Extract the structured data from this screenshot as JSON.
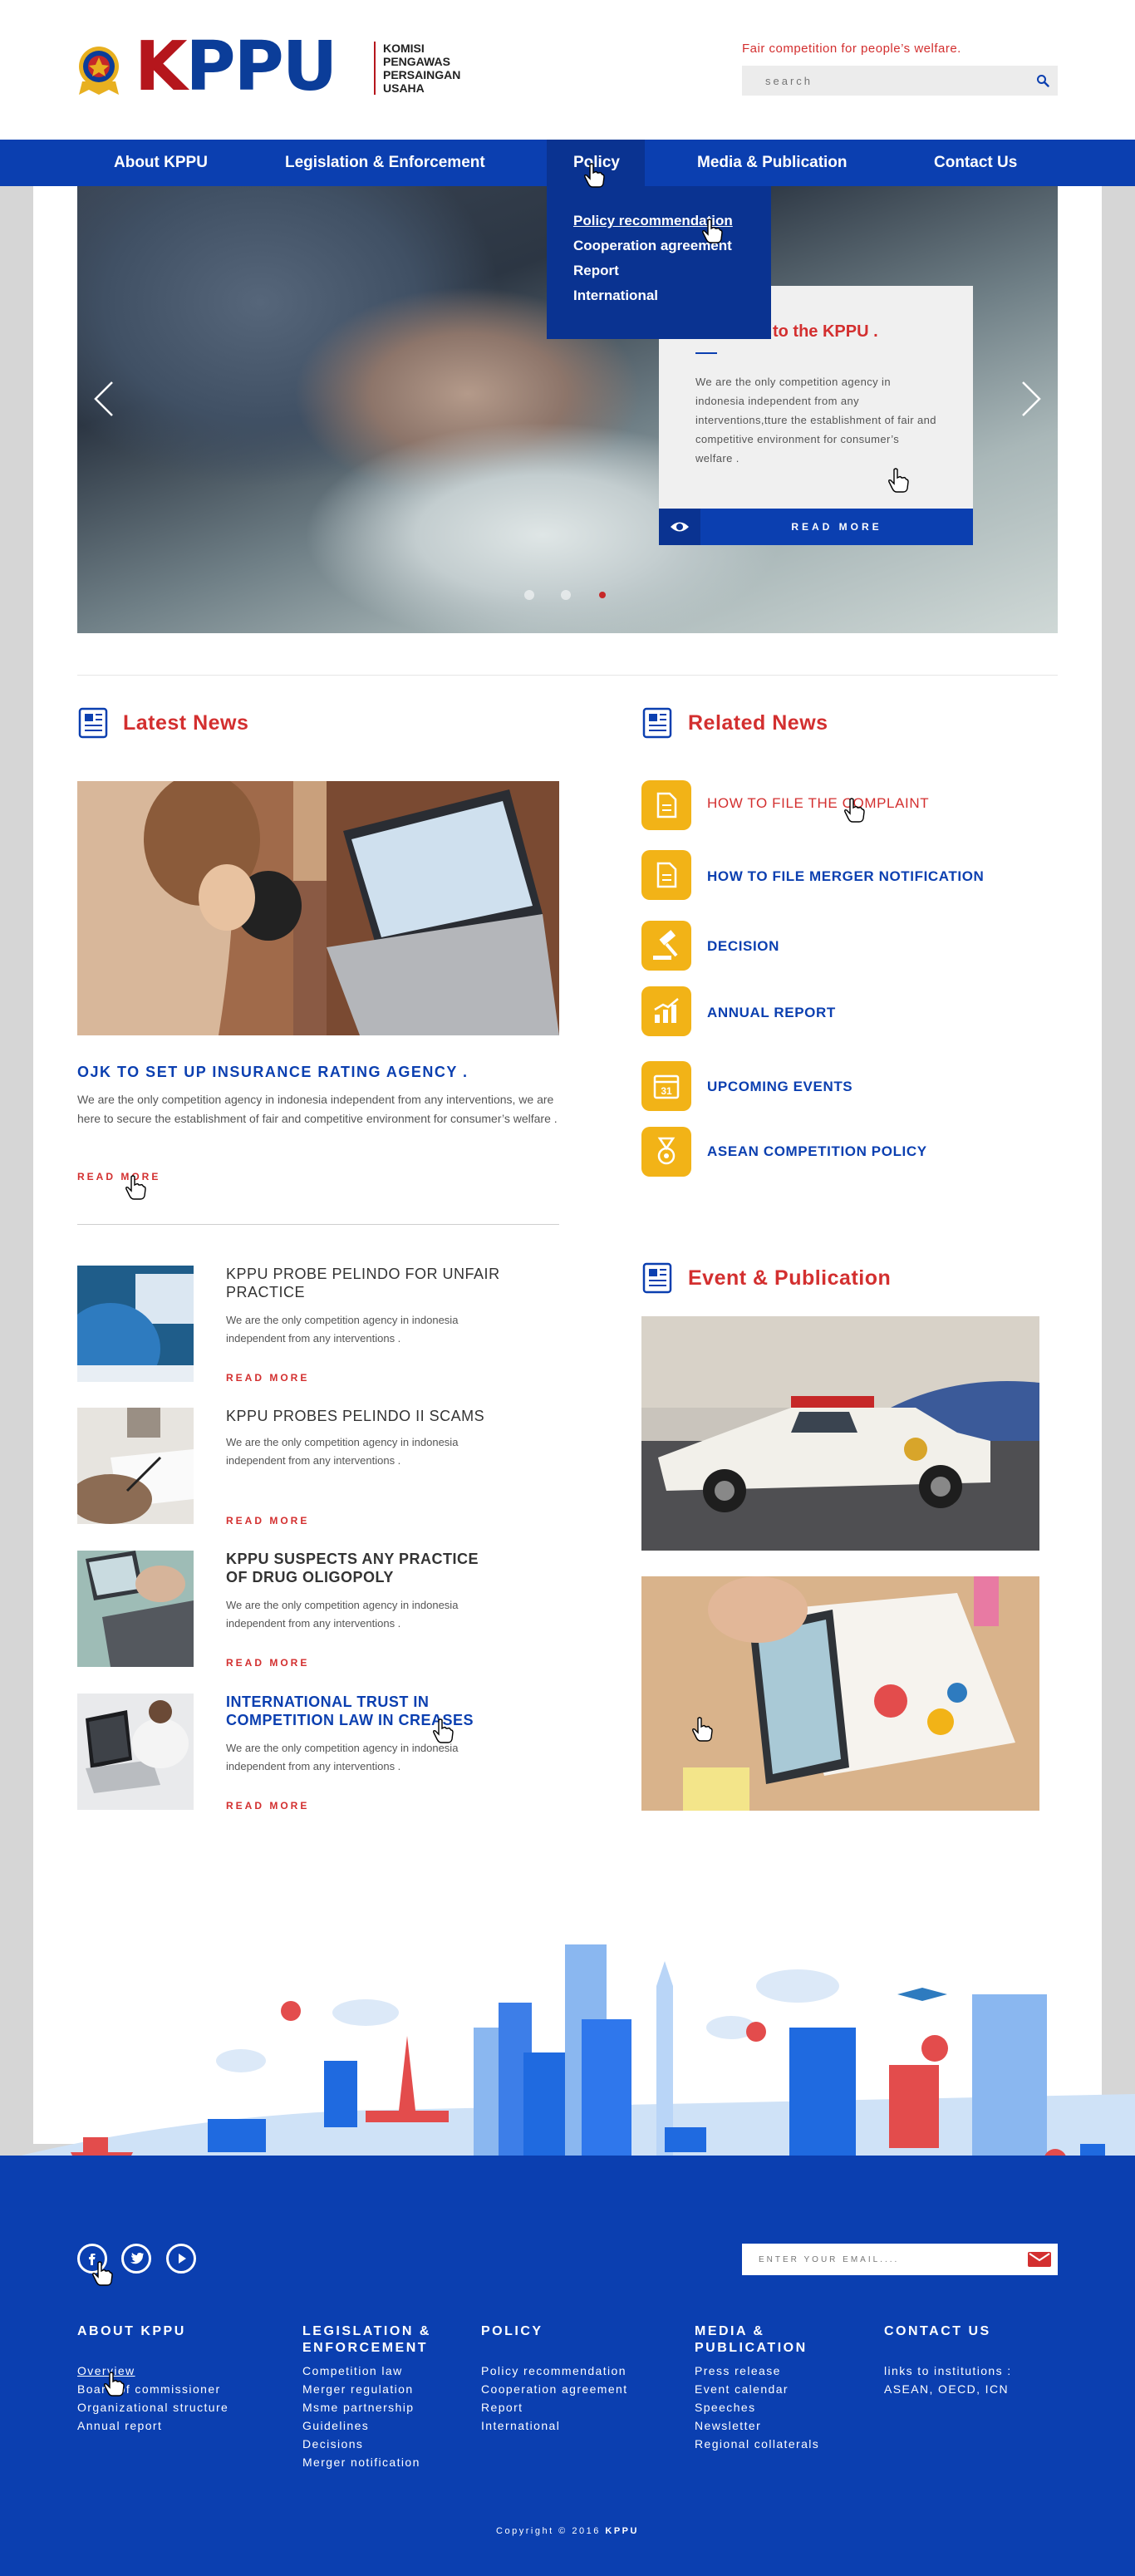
{
  "brand": {
    "logo_letters": "KPPU",
    "subtitle_lines": [
      "KOMISI",
      "PENGAWAS",
      "PERSAINGAN",
      "USAHA"
    ],
    "tagline": "Fair competition for people’s welfare.",
    "search_placeholder": "search"
  },
  "nav": {
    "items": [
      "About KPPU",
      "Legislation & Enforcement",
      "Policy",
      "Media & Publication",
      "Contact Us"
    ],
    "active": "Policy",
    "dropdown": [
      "Policy recommendation",
      "Cooperation agreement",
      "Report",
      "International"
    ]
  },
  "hero": {
    "title": "Welcome to the KPPU .",
    "body": "We are the only competition agency in indonesia independent from any interventions,tture the establishment of fair and competitive environment for consumer’s welfare .",
    "button": "READ MORE",
    "slides_total": 3,
    "slide_active": 3
  },
  "latest": {
    "heading": "Latest News",
    "featured": {
      "title": "OJK TO SET UP INSURANCE RATING AGENCY .",
      "body": "We are the only competition agency in indonesia independent from any interventions, we are here to secure the establishment of fair and competitive environment for consumer’s welfare .",
      "read_more": "READ MORE"
    },
    "items": [
      {
        "title": "KPPU PROBE PELINDO FOR UNFAIR PRACTICE",
        "body": "We are the only competition agency in indonesia independent from any interventions .",
        "read_more": "READ MORE"
      },
      {
        "title": "KPPU PROBES PELINDO II SCAMS",
        "body": "We are the only competition agency in indonesia independent from any interventions .",
        "read_more": "READ MORE"
      },
      {
        "title": "KPPU SUSPECTS ANY PRACTICE OF DRUG OLIGOPOLY",
        "body": "We are the only competition agency in indonesia independent from any interventions .",
        "read_more": "READ MORE"
      },
      {
        "title": "INTERNATIONAL TRUST IN COMPETITION LAW IN CREASES",
        "body": "We are the only competition agency in indonesia independent from any interventions .",
        "read_more": "READ MORE"
      }
    ]
  },
  "related": {
    "heading": "Related News",
    "items": [
      {
        "label": "HOW TO FILE THE COMPLAINT",
        "icon": "document-icon"
      },
      {
        "label": "HOW TO FILE MERGER NOTIFICATION",
        "icon": "document-icon"
      },
      {
        "label": "DECISION",
        "icon": "gavel-icon"
      },
      {
        "label": "ANNUAL REPORT",
        "icon": "chart-icon"
      },
      {
        "label": "UPCOMING EVENTS",
        "icon": "calendar-icon"
      },
      {
        "label": "ASEAN COMPETITION POLICY",
        "icon": "medal-icon"
      }
    ],
    "calendar_day": "31"
  },
  "events": {
    "heading": "Event & Publication"
  },
  "footer": {
    "email_placeholder": "ENTER YOUR EMAIL....",
    "columns": [
      {
        "heading": "ABOUT KPPU",
        "links": [
          "Overview",
          "Board of commissioner",
          "Organizational structure",
          "Annual report"
        ]
      },
      {
        "heading": "LEGISLATION & ENFORCEMENT",
        "links": [
          "Competition law",
          "Merger regulation",
          "Msme partnership",
          "Guidelines",
          "Decisions",
          "Merger notification"
        ]
      },
      {
        "heading": "POLICY",
        "links": [
          "Policy recommendation",
          "Cooperation agreement",
          "Report",
          "International"
        ]
      },
      {
        "heading": "MEDIA & PUBLICATION",
        "links": [
          "Press release",
          "Event calendar",
          "Speeches",
          "Newsletter",
          "Regional collaterals"
        ]
      },
      {
        "heading": "CONTACT US",
        "links": [
          "links to institutions :",
          "ASEAN, OECD, ICN"
        ]
      }
    ],
    "copyright": "Copyright © 2016",
    "copyright_brand": "KPPU"
  },
  "colors": {
    "primary": "#0b3fb0",
    "accent_red": "#d32f2f",
    "icon_yellow": "#f2b317"
  }
}
